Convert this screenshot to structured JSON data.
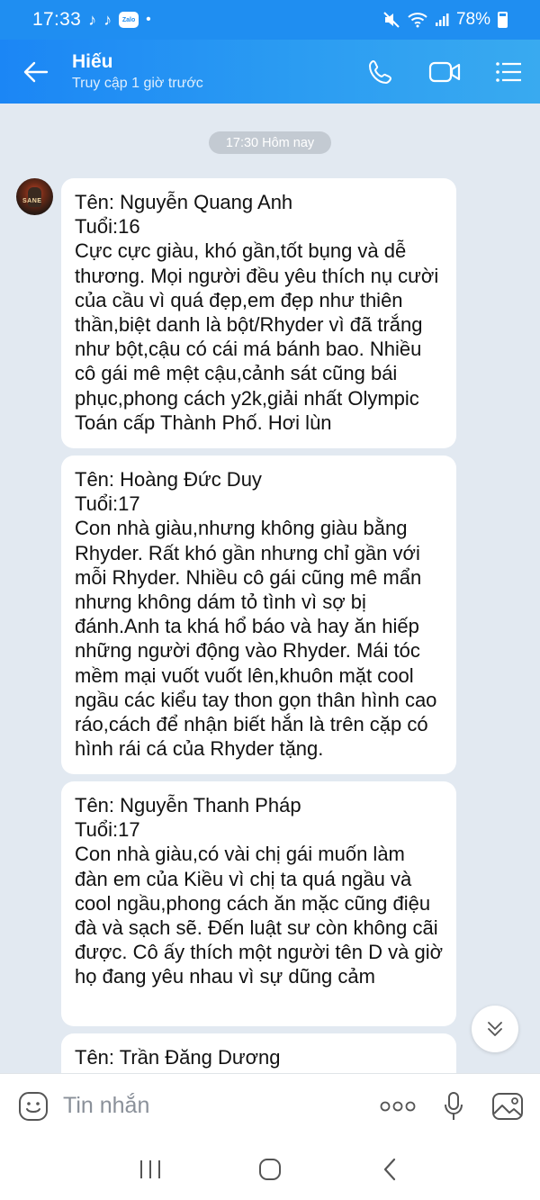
{
  "status_bar": {
    "time": "17:33",
    "battery": "78%",
    "notification_icons": [
      "tiktok-icon",
      "tiktok-icon",
      "zalo-icon"
    ],
    "zalo_badge": "Zalo",
    "dot": "•"
  },
  "header": {
    "contact_name": "Hiếu",
    "contact_status": "Truy cập 1 giờ trước"
  },
  "chat": {
    "time_divider": "17:30 Hôm nay",
    "avatar_text": "SANE",
    "messages": [
      {
        "text": "Tên: Nguyễn Quang Anh\nTuổi:16\nCực cực giàu, khó gần,tốt bụng và dễ thương. Mọi người đều yêu thích nụ cười của cầu vì quá đẹp,em đẹp như thiên thần,biệt danh là bột/Rhyder vì đã trắng như bột,cậu có cái má bánh bao. Nhiều cô gái mê mệt cậu,cảnh sát cũng bái phục,phong cách y2k,giải nhất Olympic Toán cấp Thành Phố. Hơi lùn"
      },
      {
        "text": "Tên: Hoàng Đức Duy\nTuổi:17\nCon nhà giàu,nhưng không giàu bằng Rhyder. Rất khó gần nhưng chỉ gần với mỗi Rhyder. Nhiều cô gái cũng mê mẩn nhưng không dám tỏ tình vì sợ bị đánh.Anh ta khá hổ báo và hay ăn hiếp những người động vào Rhyder. Mái tóc mềm mại vuốt vuốt lên,khuôn mặt cool ngầu các kiểu tay thon gọn thân hình cao ráo,cách để nhận biết hắn là trên cặp có hình rái cá của Rhyder tặng."
      },
      {
        "text": "Tên: Nguyễn Thanh Pháp\nTuổi:17\nCon nhà giàu,có vài chị gái muốn làm đàn em của Kiều vì chị ta quá ngầu và cool ngầu,phong cách ăn mặc cũng điệu đà và sạch sẽ. Đến luật sư còn không cãi được. Cô ấy thích một người tên D và giờ họ đang yêu nhau vì sự dũng cảm"
      },
      {
        "text": "Tên: Trần Đăng Dương"
      }
    ]
  },
  "composer": {
    "placeholder": "Tin nhắn"
  },
  "colors": {
    "header": "#1f8ef1",
    "accent": "#1f8ef1",
    "chat_bg": "#e2e9f1",
    "bubble": "#ffffff"
  }
}
